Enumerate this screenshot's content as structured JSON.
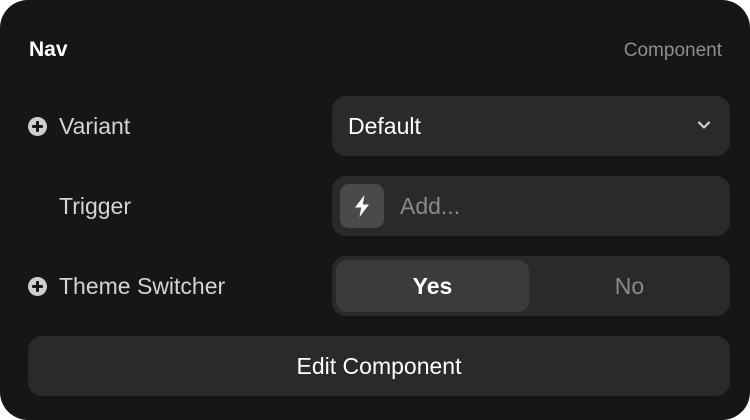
{
  "panel": {
    "title": "Nav",
    "type_label": "Component"
  },
  "rows": [
    {
      "label": "Variant",
      "has_add_icon": true,
      "icon": "plus-circle-icon"
    },
    {
      "label": "Trigger",
      "has_add_icon": false
    },
    {
      "label": "Theme Switcher",
      "has_add_icon": true,
      "icon": "plus-circle-icon"
    }
  ],
  "variant_select": {
    "value": "Default",
    "icon": "chevron-down-icon"
  },
  "trigger_field": {
    "placeholder": "Add...",
    "icon": "lightning-bolt-icon"
  },
  "theme_switcher": {
    "options": [
      "Yes",
      "No"
    ],
    "selected": "Yes"
  },
  "edit_button": {
    "label": "Edit Component"
  },
  "colors": {
    "panel_bg": "#161616",
    "control_bg": "#2a2a2a",
    "selected_segment_bg": "#3b3b3b",
    "muted_text": "#8a8a8a"
  }
}
